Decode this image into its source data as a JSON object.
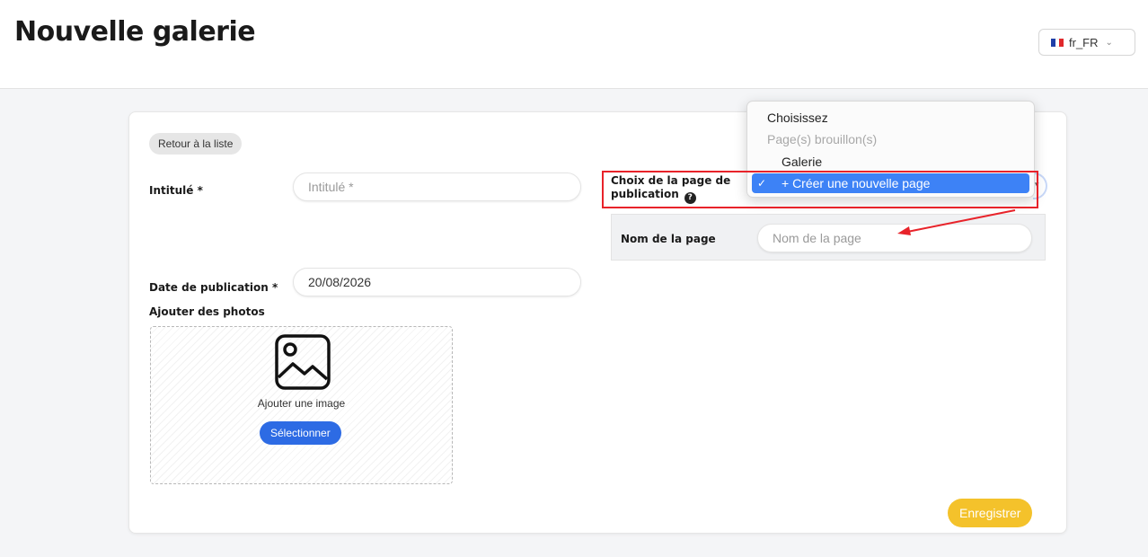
{
  "header": {
    "title": "Nouvelle galerie",
    "language": "fr_FR"
  },
  "form": {
    "back_label": "Retour à la liste",
    "title_label": "Intitulé *",
    "title_placeholder": "Intitulé *",
    "page_choice_label_line1": "Choix de la page de",
    "page_choice_label_line2": "publication",
    "page_name_label": "Nom de la page",
    "page_name_placeholder": "Nom de la page",
    "date_label": "Date de publication *",
    "date_value": "20/08/2026",
    "photos_label": "Ajouter des photos",
    "upload_caption": "Ajouter une image",
    "upload_button": "Sélectionner",
    "save_button": "Enregistrer"
  },
  "dropdown": {
    "items": [
      {
        "label": "Choisissez",
        "disabled": false
      },
      {
        "label": "Page(s) brouillon(s)",
        "disabled": true
      },
      {
        "label": "Galerie",
        "disabled": false
      },
      {
        "label": "+ Créer une nouvelle page",
        "selected": true
      }
    ]
  },
  "colors": {
    "primary_blue": "#2d6be4",
    "save_yellow": "#f4c22b",
    "annotation_red": "#e8232a",
    "selected_highlight": "#3d82f6"
  },
  "icons": {
    "image": "image-placeholder-icon",
    "help": "question-circle-icon",
    "check": "checkmark-icon",
    "chevron": "chevron-down-icon"
  }
}
